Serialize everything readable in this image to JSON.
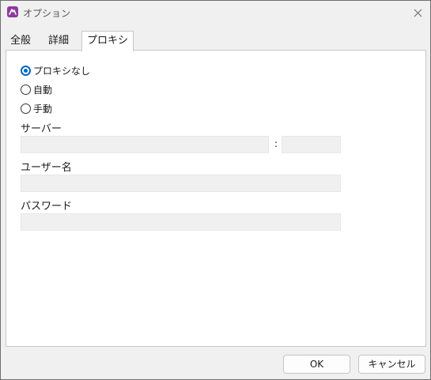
{
  "window": {
    "title": "オプション",
    "icon": "app-logo-icon",
    "accent_color": "#0067c0",
    "icon_color": "#8e3a9e"
  },
  "tabs": [
    {
      "label": "全般",
      "active": false
    },
    {
      "label": "詳細",
      "active": false
    },
    {
      "label": "プロキシ",
      "active": true
    }
  ],
  "proxy": {
    "options": [
      {
        "label": "プロキシなし",
        "checked": true
      },
      {
        "label": "自動",
        "checked": false
      },
      {
        "label": "手動",
        "checked": false
      }
    ],
    "server_label": "サーバー",
    "server_value": "",
    "port_separator": ":",
    "port_value": "",
    "username_label": "ユーザー名",
    "username_value": "",
    "password_label": "パスワード",
    "password_value": ""
  },
  "buttons": {
    "ok": "OK",
    "cancel": "キャンセル"
  }
}
